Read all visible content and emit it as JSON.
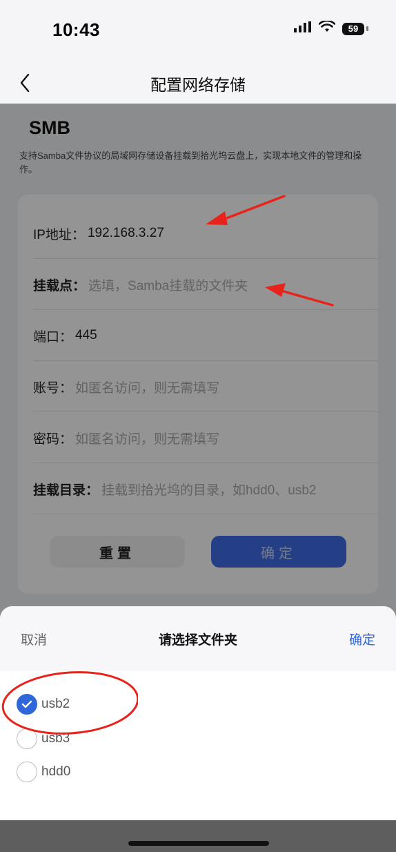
{
  "status_bar": {
    "time": "10:43",
    "battery": "59",
    "icons": [
      "signal-icon",
      "wifi-icon",
      "battery-icon"
    ]
  },
  "nav": {
    "title": "配置网络存储",
    "back_icon": "chevron-left-icon"
  },
  "smb": {
    "title": "SMB",
    "description": "支持Samba文件协议的局域网存储设备挂载到拾光坞云盘上，实现本地文件的管理和操作。"
  },
  "form": {
    "ip": {
      "label": "IP地址：",
      "value": "192.168.3.27"
    },
    "mount_point": {
      "label": "挂载点：",
      "placeholder": "选填，Samba挂载的文件夹"
    },
    "port": {
      "label": "端口：",
      "value": "445"
    },
    "account": {
      "label": "账号：",
      "placeholder": "如匿名访问，则无需填写"
    },
    "password": {
      "label": "密码：",
      "placeholder": "如匿名访问，则无需填写"
    },
    "mount_dir": {
      "label": "挂载目录：",
      "placeholder": "挂载到拾光坞的目录，如hdd0、usb2"
    },
    "reset_label": "重置",
    "confirm_label": "确定"
  },
  "sheet": {
    "cancel_label": "取消",
    "title": "请选择文件夹",
    "ok_label": "确定",
    "options": [
      {
        "label": "usb2",
        "checked": true
      },
      {
        "label": "usb3",
        "checked": false
      },
      {
        "label": "hdd0",
        "checked": false
      }
    ]
  },
  "colors": {
    "accent": "#2f66d9",
    "confirm_button": "#3f6de6",
    "annotation_red": "#e8231c"
  }
}
